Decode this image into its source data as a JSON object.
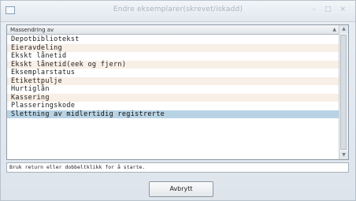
{
  "window": {
    "title": "Endre eksemplarer(skrevet/iskadd)",
    "controls": "– □ ×"
  },
  "list": {
    "column_header": "Massendring av",
    "sort_indicator": "▲",
    "items": [
      "Depotbibliotekst",
      "Eieravdeling",
      "Ekskt lånetid",
      "Ekskt lånetid(eek og fjern)",
      "Eksemplarstatus",
      "Etikettpulje",
      "Hurtiglån",
      "Kassering",
      "Plasseringskode",
      "Slettning av midlertidig registrerte"
    ],
    "selected_index": 9
  },
  "scrollbar": {
    "up": "▲",
    "down": "▼"
  },
  "hint": "Bruk return eller dobbeltklikk for å starte.",
  "buttons": {
    "cancel": "Avbrytt"
  },
  "colors": {
    "alternate_row": "#f8efe6",
    "selected_row": "#b8d3e4"
  }
}
